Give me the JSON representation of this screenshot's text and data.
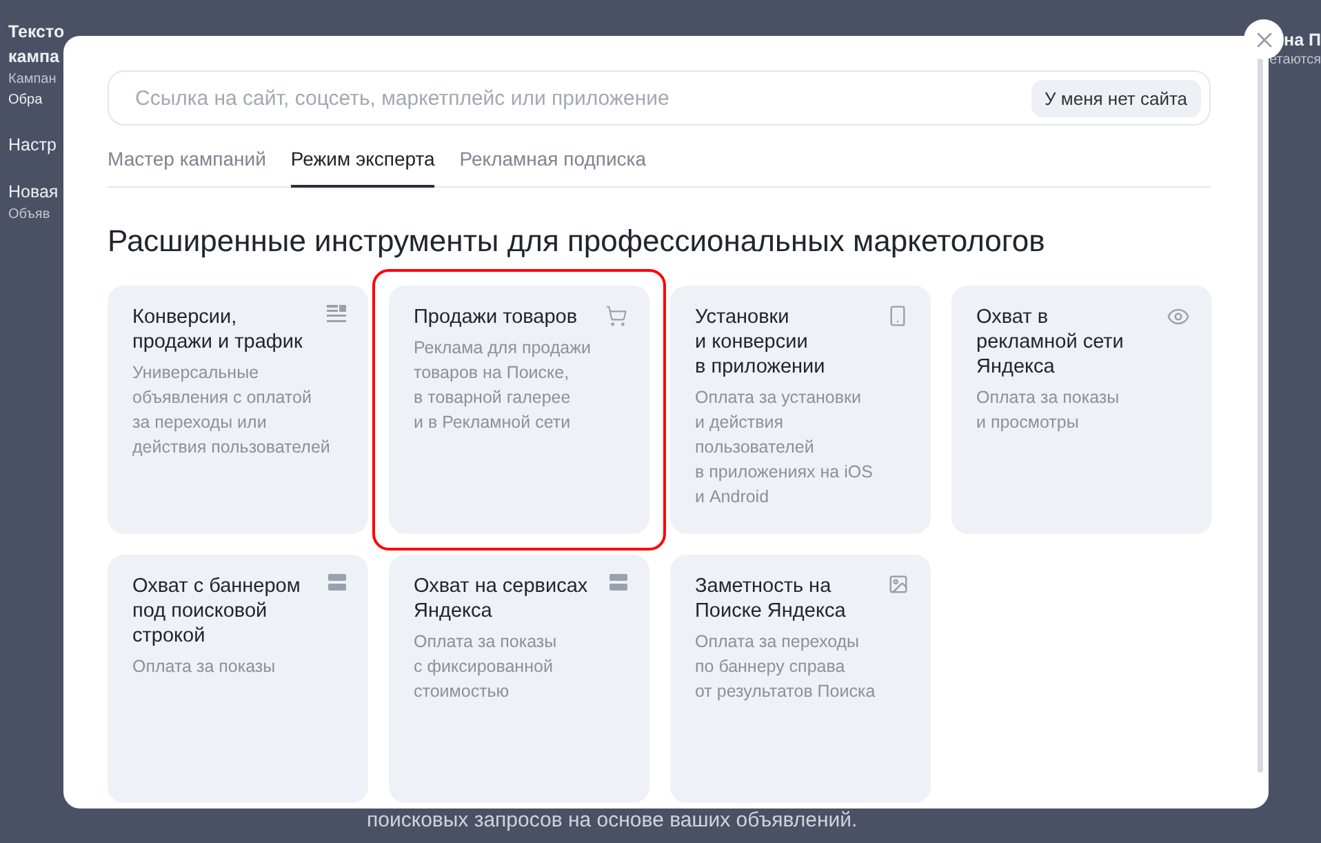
{
  "background": {
    "left_texts": [
      {
        "kind": "title",
        "text": "Тексто"
      },
      {
        "kind": "title",
        "text": "кампа"
      },
      {
        "kind": "sub",
        "text": "Кампан"
      },
      {
        "kind": "status",
        "text": "Обра"
      },
      {
        "kind": "item",
        "text": "Настр"
      },
      {
        "kind": "item",
        "text": "Новая"
      },
      {
        "kind": "muted",
        "text": "Объяв"
      }
    ],
    "right_texts": [
      {
        "kind": "title",
        "text": "на П"
      },
      {
        "kind": "sub",
        "text": "етаются"
      }
    ],
    "bottom_text": "поисковых запросов на основе ваших объявлений."
  },
  "modal": {
    "search": {
      "placeholder": "Ссылка на сайт, соцсеть, маркетплейс или приложение"
    },
    "no_site_button": "У меня нет сайта",
    "tabs": [
      {
        "label": "Мастер кампаний",
        "selected": false
      },
      {
        "label": "Режим эксперта",
        "selected": true
      },
      {
        "label": "Рекламная подписка",
        "selected": false
      }
    ],
    "heading": "Расширенные инструменты для профессиональных маркетологов",
    "cards": [
      {
        "kind": "list",
        "title": "Конверсии,\nпродажи и трафик",
        "description": "Универсальные\nобъявления с оплатой\nза переходы или\nдействия пользователей",
        "selected": false
      },
      {
        "kind": "cart",
        "title": "Продажи товаров",
        "description": "Реклама для продажи\nтоваров на Поиске,\nв товарной галерее\nи в Рекламной сети",
        "selected": true
      },
      {
        "kind": "phone",
        "title": "Установки\nи конверсии\nв приложении",
        "description": "Оплата за установки\nи действия\nпользователей\nв приложениях на iOS\nи Android",
        "selected": false
      },
      {
        "kind": "eye",
        "title": "Охват в\nрекламной сети\nЯндекса",
        "description": "Оплата за показы\nи просмотры",
        "selected": false
      },
      {
        "kind": "banner",
        "title": "Охват с баннером\nпод поисковой\nстрокой",
        "description": "Оплата за показы",
        "selected": false
      },
      {
        "kind": "banner",
        "title": "Охват на сервисах\nЯндекса",
        "description": "Оплата за показы\nс фиксированной\nстоимостью",
        "selected": false
      },
      {
        "kind": "image",
        "title": "Заметность на\nПоиске Яндекса",
        "description": "Оплата за переходы\nпо баннеру справа\nот результатов Поиска",
        "selected": false
      }
    ]
  }
}
